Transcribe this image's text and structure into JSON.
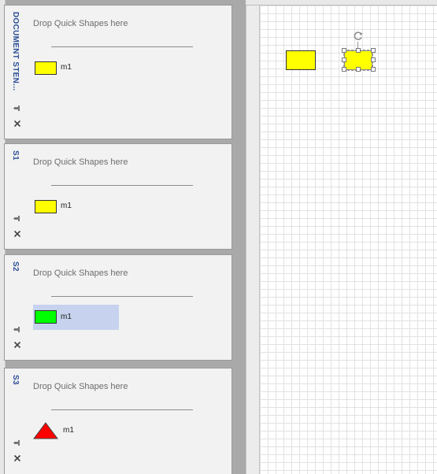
{
  "stencils": [
    {
      "title": "DOCUMENT STEN...",
      "drop_text": "Drop Quick Shapes here",
      "shape": {
        "label": "m1",
        "kind": "rectangle",
        "fill": "#ffff00",
        "selected": false
      }
    },
    {
      "title": "S1",
      "drop_text": "Drop Quick Shapes here",
      "shape": {
        "label": "m1",
        "kind": "rectangle",
        "fill": "#ffff00",
        "selected": false
      }
    },
    {
      "title": "S2",
      "drop_text": "Drop Quick Shapes here",
      "shape": {
        "label": "m1",
        "kind": "rectangle",
        "fill": "#00ff00",
        "selected": true
      }
    },
    {
      "title": "S3",
      "drop_text": "Drop Quick Shapes here",
      "shape": {
        "label": "m1",
        "kind": "triangle",
        "fill": "#ff0000",
        "selected": false
      }
    }
  ],
  "icons": {
    "pin": "pin-icon",
    "close": "close-icon",
    "rotate": "rotate-handle-icon"
  },
  "canvas": {
    "shapes": [
      {
        "kind": "rectangle",
        "fill": "#ffff00",
        "selected": false
      },
      {
        "kind": "rectangle",
        "fill": "#ffff00",
        "selected": true
      }
    ]
  },
  "colors": {
    "title_accent": "#2b4f97",
    "selection_highlight": "#c6d2ee"
  }
}
